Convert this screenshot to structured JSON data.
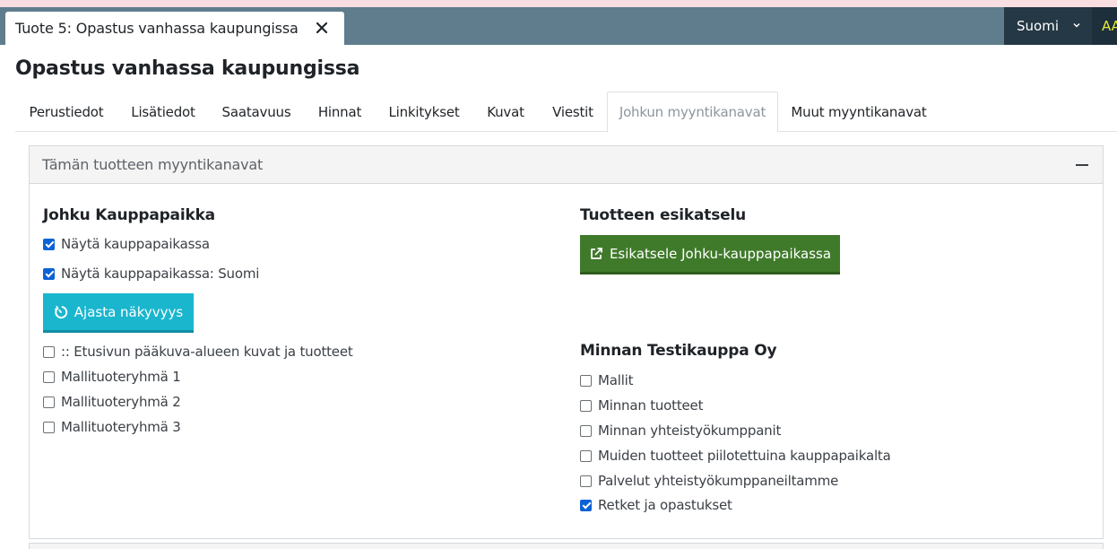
{
  "window": {
    "doc_tab_title": "Tuote 5: Opastus vanhassa kaupungissa",
    "close_icon": "close-icon",
    "language": "Suomi",
    "language_icon": "chevron-down-icon",
    "user_initials": "AA"
  },
  "page": {
    "title": "Opastus vanhassa kaupungissa"
  },
  "tabs": [
    {
      "label": "Perustiedot",
      "active": false
    },
    {
      "label": "Lisätiedot",
      "active": false
    },
    {
      "label": "Saatavuus",
      "active": false
    },
    {
      "label": "Hinnat",
      "active": false
    },
    {
      "label": "Linkitykset",
      "active": false
    },
    {
      "label": "Kuvat",
      "active": false
    },
    {
      "label": "Viestit",
      "active": false
    },
    {
      "label": "Johkun myyntikanavat",
      "active": true
    },
    {
      "label": "Muut myyntikanavat",
      "active": false
    }
  ],
  "panel": {
    "title": "Tämän tuotteen myyntikanavat",
    "collapse_icon": "minus-icon"
  },
  "marketplace": {
    "title": "Johku Kauppapaikka",
    "options": [
      {
        "label": "Näytä kauppapaikassa",
        "checked": true
      },
      {
        "label": "Näytä kauppapaikassa: Suomi",
        "checked": true
      }
    ],
    "schedule_button": "Ajasta näkyvyys",
    "schedule_icon": "timer-icon",
    "categories": [
      {
        "label": ":: Etusivun pääkuva-alueen kuvat ja tuotteet",
        "checked": false
      },
      {
        "label": "Mallituoteryhmä 1",
        "checked": false
      },
      {
        "label": "Mallituoteryhmä 2",
        "checked": false
      },
      {
        "label": "Mallituoteryhmä 3",
        "checked": false
      }
    ]
  },
  "preview": {
    "title": "Tuotteen esikatselu",
    "button": "Esikatsele Johku-kauppapaikassa",
    "button_icon": "external-link-icon"
  },
  "shop": {
    "title": "Minnan Testikauppa Oy",
    "categories": [
      {
        "label": "Mallit",
        "checked": false
      },
      {
        "label": "Minnan tuotteet",
        "checked": false
      },
      {
        "label": "Minnan yhteistyökumppanit",
        "checked": false
      },
      {
        "label": "Muiden tuotteet piilotettuina kauppapaikalta",
        "checked": false
      },
      {
        "label": "Palvelut yhteistyökumppaneiltamme",
        "checked": false
      },
      {
        "label": "Retket ja opastukset",
        "checked": true
      }
    ]
  },
  "colors": {
    "topbar": "#5f7d8c",
    "language_bg": "#243845",
    "schedule_button": "#19b6ce",
    "preview_button": "#3f7a2a",
    "checkbox_checked": "#0b62d6"
  }
}
